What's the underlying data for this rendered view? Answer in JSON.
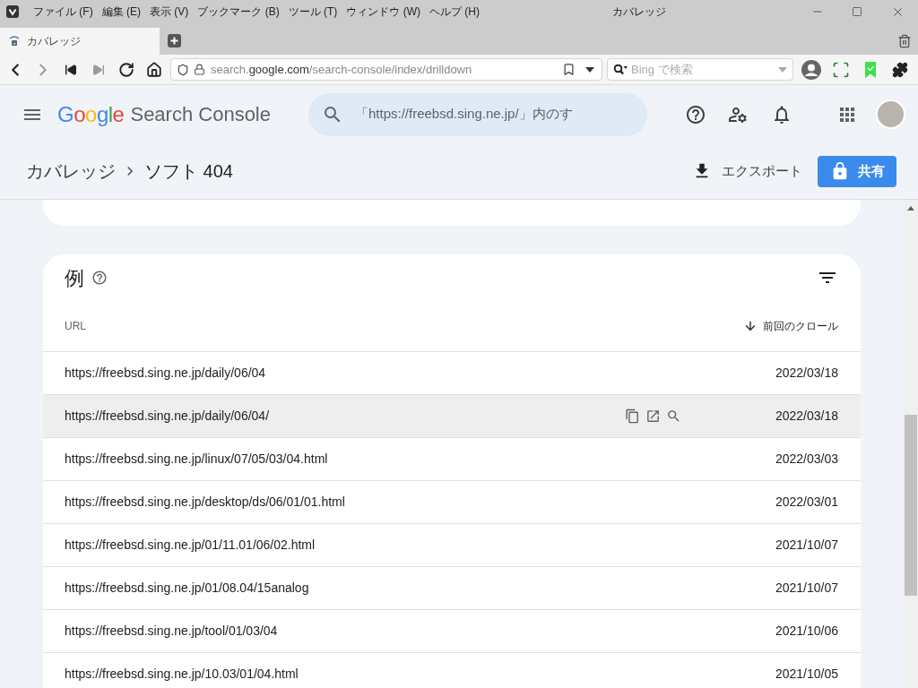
{
  "browser": {
    "menu": [
      "ファイル (F)",
      "編集 (E)",
      "表示 (V)",
      "ブックマーク (B)",
      "ツール (T)",
      "ウィンドウ (W)",
      "ヘルプ (H)"
    ],
    "window_title": "カバレッジ",
    "tabs": [
      {
        "title": "カバレッジ",
        "selected": true
      }
    ],
    "address": {
      "subdomain": "search.",
      "domain": "google.com",
      "path": "/search-console/index/drilldown"
    },
    "search": {
      "placeholder": "Bing で検索"
    }
  },
  "app": {
    "logo": "Google",
    "product": "Search Console",
    "search": {
      "placeholder": "「https://freebsd.sing.ne.jp/」内のす"
    }
  },
  "breadcrumb": [
    "カバレッジ",
    "ソフト 404"
  ],
  "actions": {
    "export": "エクスポート",
    "share": "共有"
  },
  "examples": {
    "title": "例",
    "columns": [
      {
        "label": "URL",
        "sorted": false
      },
      {
        "label": "前回のクロール",
        "sorted": true
      }
    ],
    "rows": [
      {
        "url": "https://freebsd.sing.ne.jp/daily/06/04",
        "last_crawl": "2022/03/18",
        "highlighted": false
      },
      {
        "url": "https://freebsd.sing.ne.jp/daily/06/04/",
        "last_crawl": "2022/03/18",
        "highlighted": true
      },
      {
        "url": "https://freebsd.sing.ne.jp/linux/07/05/03/04.html",
        "last_crawl": "2022/03/03",
        "highlighted": false
      },
      {
        "url": "https://freebsd.sing.ne.jp/desktop/ds/06/01/01.html",
        "last_crawl": "2022/03/01",
        "highlighted": false
      },
      {
        "url": "https://freebsd.sing.ne.jp/01/11.01/06/02.html",
        "last_crawl": "2021/10/07",
        "highlighted": false
      },
      {
        "url": "https://freebsd.sing.ne.jp/01/08.04/15analog",
        "last_crawl": "2021/10/07",
        "highlighted": false
      },
      {
        "url": "https://freebsd.sing.ne.jp/tool/01/03/04",
        "last_crawl": "2021/10/06",
        "highlighted": false
      },
      {
        "url": "https://freebsd.sing.ne.jp/10.03/01/04.html",
        "last_crawl": "2021/10/05",
        "highlighted": false
      }
    ]
  }
}
